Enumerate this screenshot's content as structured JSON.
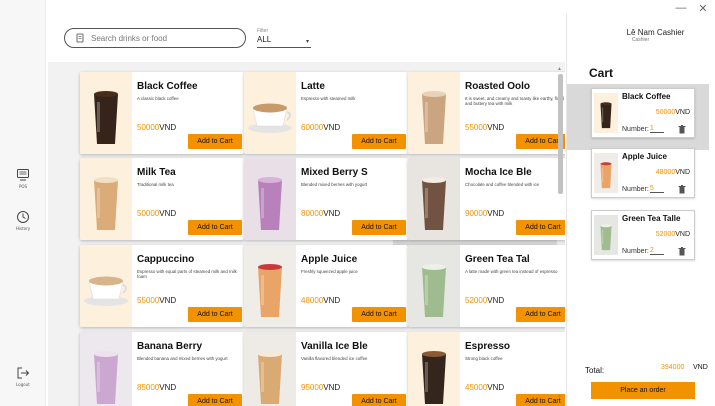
{
  "window": {
    "minimize_glyph": "—",
    "close_glyph": "✕"
  },
  "nav": [
    {
      "label": "POS",
      "icon": "pos-icon"
    },
    {
      "label": "History",
      "icon": "clock-icon"
    },
    {
      "label": "Logout",
      "icon": "logout-icon"
    }
  ],
  "search": {
    "placeholder": "Search drinks or food"
  },
  "filter": {
    "caption": "Filter",
    "value": "ALL"
  },
  "currency": "VND",
  "add_label": "Add to Cart",
  "products": [
    {
      "name": "Black Coffee",
      "desc": "A classic black coffee",
      "price": "50000",
      "image": "black-coffee-image"
    },
    {
      "name": "Latte",
      "desc": "Espresso with steamed milk",
      "price": "60000",
      "image": "latte-image"
    },
    {
      "name": "Roasted Oolo",
      "desc": "It is sweet, and creamy and toasty like earthy, floral and buttery tea with milk",
      "price": "55000",
      "image": "roasted-oolong-image"
    },
    {
      "name": "Milk Tea",
      "desc": "Traditional milk tea",
      "price": "50000",
      "image": "milk-tea-image"
    },
    {
      "name": "Mixed Berry S",
      "desc": "Blended mixed berries with yogurt",
      "price": "80000",
      "image": "mixed-berry-image"
    },
    {
      "name": "Mocha Ice Ble",
      "desc": "Chocolate and coffee blended with ice",
      "price": "90000",
      "image": "mocha-image"
    },
    {
      "name": "Cappuccino",
      "desc": "Espresso with equal parts of steamed milk and milk foam",
      "price": "55000",
      "image": "cappuccino-image"
    },
    {
      "name": "Apple Juice",
      "desc": "Freshly squeezed apple juice",
      "price": "48000",
      "image": "apple-juice-image"
    },
    {
      "name": "Green Tea Tal",
      "desc": "A latte made with green tea instead of espresso",
      "price": "52000",
      "image": "green-tea-image"
    },
    {
      "name": "Banana Berry",
      "desc": "Blended banana and mixed berries with yogurt",
      "price": "85000",
      "image": "banana-berry-image"
    },
    {
      "name": "Vanilla Ice Ble",
      "desc": "Vanilla flavored blended ice coffee",
      "price": "95000",
      "image": "vanilla-image"
    },
    {
      "name": "Espresso",
      "desc": "Strong black coffee",
      "price": "45000",
      "image": "espresso-image"
    }
  ],
  "user": {
    "name": "Lê Nam Cashier",
    "role": "Cashier"
  },
  "cart": {
    "title": "Cart",
    "number_label": "Number:",
    "items": [
      {
        "name": "Black Coffee",
        "price": "50000",
        "qty": "1",
        "image": "black-coffee-image"
      },
      {
        "name": "Apple Juice",
        "price": "48000",
        "qty": "5",
        "image": "apple-juice-image"
      },
      {
        "name": "Green Tea Talle",
        "price": "52000",
        "qty": "2",
        "image": "green-tea-image"
      }
    ],
    "total_label": "Total:",
    "total_value": "394000",
    "order_label": "Place an order"
  },
  "colors": {
    "accent": "#f39200",
    "selected": "#d9d9d9"
  }
}
